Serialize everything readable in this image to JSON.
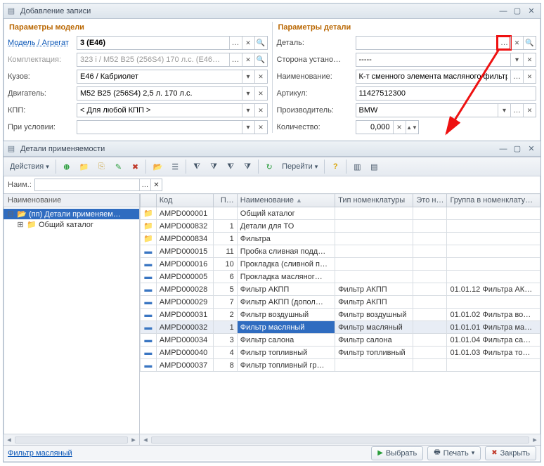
{
  "win1": {
    "title": "Добавление записи",
    "left_header": "Параметры модели",
    "right_header": "Параметры детали",
    "left": {
      "model_label": "Модель / Агрегат",
      "model_value": "3 (E46)",
      "kompl_label": "Комплектация:",
      "kompl_value": "323 i / M52 B25 (256S4) 170 л.с. (E46…",
      "kuzov_label": "Кузов:",
      "kuzov_value": "E46 / Кабриолет",
      "dvig_label": "Двигатель:",
      "dvig_value": "M52 B25 (256S4) 2,5 л. 170 л.с.",
      "kpp_label": "КПП:",
      "kpp_value": "< Для любой КПП >",
      "cond_label": "При условии:",
      "cond_value": ""
    },
    "right": {
      "detail_label": "Деталь:",
      "detail_value": "",
      "side_label": "Сторона устано…",
      "side_value": "-----",
      "name_label": "Наименование:",
      "name_value": "К-т сменного элемента масляного фильтра …",
      "art_label": "Артикул:",
      "art_value": "11427512300",
      "prod_label": "Производитель:",
      "prod_value": "BMW",
      "qty_label": "Количество:",
      "qty_value": "0,000"
    }
  },
  "win2": {
    "title": "Детали применяемости",
    "toolbar": {
      "actions_label": "Действия",
      "go_label": "Перейти"
    },
    "naim_label": "Наим.:",
    "tree_header": "Наименование",
    "tree": {
      "root": "(пп) Детали применяем…",
      "child": "Общий каталог"
    },
    "grid": {
      "cols": {
        "code": "Код",
        "p": "П…",
        "name": "Наименование",
        "type": "Тип номенклатуры",
        "eto": "Это н…",
        "group": "Группа в номенклату…"
      },
      "rows": [
        {
          "kind": "folder",
          "code": "AMPD000001",
          "p": "",
          "name": "Общий каталог",
          "type": "",
          "group": ""
        },
        {
          "kind": "folder",
          "code": "AMPD000832",
          "p": "1",
          "name": "Детали для ТО",
          "type": "",
          "group": ""
        },
        {
          "kind": "folder",
          "code": "AMPD000834",
          "p": "1",
          "name": "Фильтра",
          "type": "",
          "group": ""
        },
        {
          "kind": "item",
          "code": "AMPD000015",
          "p": "11",
          "name": "Пробка сливная подд…",
          "type": "",
          "group": ""
        },
        {
          "kind": "item",
          "code": "AMPD000016",
          "p": "10",
          "name": "Прокладка (сливной п…",
          "type": "",
          "group": ""
        },
        {
          "kind": "item",
          "code": "AMPD000005",
          "p": "6",
          "name": "Прокладка масляног…",
          "type": "",
          "group": ""
        },
        {
          "kind": "item",
          "code": "AMPD000028",
          "p": "5",
          "name": "Фильтр АКПП",
          "type": "Фильтр АКПП",
          "group": "01.01.12 Фильтра АК…"
        },
        {
          "kind": "item",
          "code": "AMPD000029",
          "p": "7",
          "name": "Фильтр АКПП (допол…",
          "type": "Фильтр АКПП",
          "group": ""
        },
        {
          "kind": "item",
          "code": "AMPD000031",
          "p": "2",
          "name": "Фильтр воздушный",
          "type": "Фильтр воздушный",
          "group": "01.01.02 Фильтра во…"
        },
        {
          "kind": "item",
          "code": "AMPD000032",
          "p": "1",
          "name": "Фильтр масляный",
          "type": "Фильтр масляный",
          "group": "01.01.01 Фильтра ма…",
          "selected": true
        },
        {
          "kind": "item",
          "code": "AMPD000034",
          "p": "3",
          "name": "Фильтр салона",
          "type": "Фильтр салона",
          "group": "01.01.04 Фильтра са…"
        },
        {
          "kind": "item",
          "code": "AMPD000040",
          "p": "4",
          "name": "Фильтр топливный",
          "type": "Фильтр топливный",
          "group": "01.01.03 Фильтра то…"
        },
        {
          "kind": "item",
          "code": "AMPD000037",
          "p": "8",
          "name": "Фильтр топливный гр…",
          "type": "",
          "group": ""
        }
      ]
    },
    "status_text": "Фильтр масляный",
    "btn_select": "Выбрать",
    "btn_print": "Печать",
    "btn_close": "Закрыть"
  }
}
